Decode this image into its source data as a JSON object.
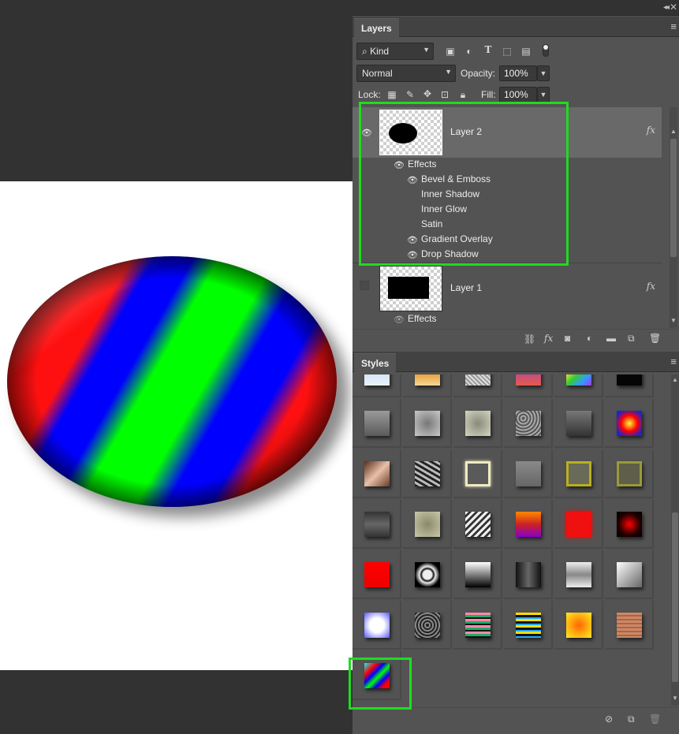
{
  "layers_panel": {
    "tab_label": "Layers",
    "filter": {
      "kind_label": "Kind"
    },
    "blend_mode": "Normal",
    "opacity_label": "Opacity:",
    "opacity_value": "100%",
    "lock_label": "Lock:",
    "fill_label": "Fill:",
    "fill_value": "100%",
    "layers": [
      {
        "name": "Layer 2",
        "selected": true,
        "visible": true,
        "fx_label": "fx",
        "effects_label": "Effects",
        "effects": [
          {
            "name": "Bevel & Emboss",
            "visible": true
          },
          {
            "name": "Inner Shadow",
            "visible": false
          },
          {
            "name": "Inner Glow",
            "visible": false
          },
          {
            "name": "Satin",
            "visible": false
          },
          {
            "name": "Gradient Overlay",
            "visible": true
          },
          {
            "name": "Drop Shadow",
            "visible": true
          }
        ]
      },
      {
        "name": "Layer 1",
        "selected": false,
        "visible": false,
        "fx_label": "fx",
        "effects_label": "Effects"
      }
    ]
  },
  "styles_panel": {
    "tab_label": "Styles",
    "swatches": [
      "sky-strip",
      "sunset-strip",
      "grain-strip",
      "blue-red-strip",
      "rainbow-strip",
      "black-strip",
      "gray-bevel",
      "gray-pillow",
      "gray-inset",
      "stone-texture",
      "dark-bevel",
      "red-blue-radial",
      "copper",
      "rough-metal",
      "outline-glow",
      "gray-bevel-2",
      "gold-frame",
      "olive-frame",
      "dark-pillow",
      "olive-inset",
      "chevron",
      "rainbow-glow",
      "red-blur",
      "dark-red-star",
      "red-bevel",
      "chrome-ring",
      "white-to-black",
      "black-tube",
      "silver-wave",
      "silver-gradient",
      "blue-glow",
      "concentric-rings",
      "stripes-pink-green",
      "stripes-yellow-black",
      "yellow-orange-radial",
      "wood-grain",
      "rgb-diagonal-stripes"
    ]
  },
  "colors": {
    "highlight": "#1fdc1f",
    "panel_bg": "#535353",
    "canvas_bg": "#ffffff"
  }
}
